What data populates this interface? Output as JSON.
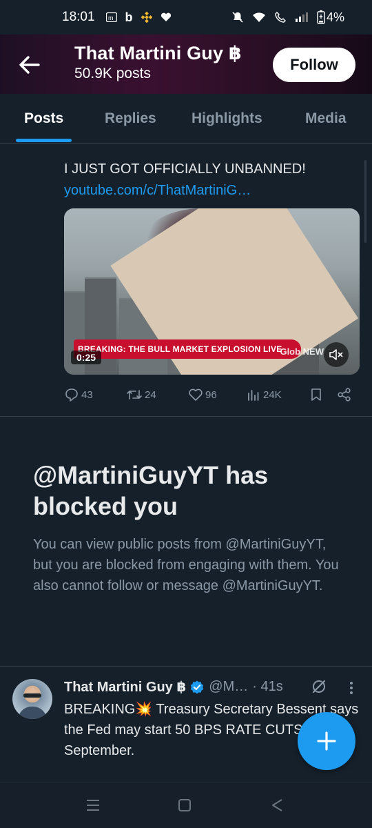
{
  "status_bar": {
    "time": "18:01",
    "battery": "4%",
    "left_icons": [
      "messenger-icon",
      "bing-icon",
      "binance-icon",
      "heart-icon"
    ],
    "right_icons": [
      "mute-icon",
      "wifi-icon",
      "wifi-call-icon",
      "signal-icon",
      "battery-icon"
    ]
  },
  "header": {
    "name": "That Martini Guy ฿",
    "post_count": "50.9K posts",
    "follow_label": "Follow"
  },
  "tabs": [
    {
      "label": "Posts",
      "active": true
    },
    {
      "label": "Replies",
      "active": false
    },
    {
      "label": "Highlights",
      "active": false
    },
    {
      "label": "Media",
      "active": false
    }
  ],
  "pinned_post": {
    "text": "I JUST GOT OFFICIALLY UNBANNED!",
    "link": "youtube.com/c/ThatMartiniG…",
    "video": {
      "banner": "BREAKING: THE BULL MARKET EXPLOSION LIVE",
      "duration": "0:25",
      "watermark": "Glob NEW"
    },
    "actions": {
      "replies": "43",
      "reposts": "24",
      "likes": "96",
      "views": "24K"
    }
  },
  "blocked": {
    "title": "@MartiniGuyYT has blocked you",
    "body": "You can view public posts from @MartiniGuyYT, but you are blocked from engaging with them. You also cannot follow or message @MartiniGuyYT."
  },
  "next_tweet": {
    "name": "That Martini Guy ฿",
    "handle": "@M…",
    "time": "· 41s",
    "body": "BREAKING💥 Treasury Secretary Bessent says the Fed may start 50 BPS RATE CUTS in September."
  },
  "colors": {
    "background": "#15202b",
    "accent": "#1d9bf0",
    "muted": "#8b98a5",
    "breaking_banner": "#c8102e"
  }
}
